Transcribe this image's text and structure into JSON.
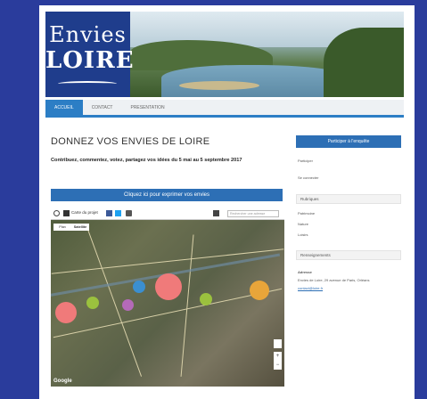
{
  "logo": {
    "line1": "Envies",
    "line2": "LOIRE"
  },
  "nav": {
    "items": [
      "ACCUEIL",
      "CONTACT",
      "PRESENTATION"
    ]
  },
  "main": {
    "title": "DONNEZ VOS ENVIES DE LOIRE",
    "intro": "Contribuez, commentez, votez, partagez vos idées du 5 mai au 5 septembre 2017",
    "cta": "Cliquez ici pour exprimer vos envies"
  },
  "map": {
    "toolbar_label": "Carte du projet",
    "search_placeholder": "Rechercher une adresse",
    "type_plan": "Plan",
    "type_satellite": "Satellite",
    "zoom_in": "+",
    "zoom_out": "−",
    "attribution": "Google",
    "markers": [
      {
        "color": "#f07a7a",
        "label": "marker-1"
      },
      {
        "color": "#9bc13e",
        "label": "marker-2"
      },
      {
        "color": "#b46ab8",
        "label": "marker-3"
      },
      {
        "color": "#3b8fd0",
        "label": "marker-4"
      },
      {
        "color": "#f07a7a",
        "label": "marker-5"
      },
      {
        "color": "#9bc13e",
        "label": "marker-6"
      },
      {
        "color": "#e8a53a",
        "label": "marker-7"
      }
    ]
  },
  "sidebar": {
    "button": "Participer à l'enquête",
    "link1": "Participer",
    "link2": "Se connecter",
    "box1_title": "Rubriques",
    "list": [
      "Patrimoine",
      "Nature",
      "Loisirs"
    ],
    "box2_title": "Renseignements",
    "contact_name": "Adresse",
    "contact_addr": "Envies de Loire, 29 avenue de Paris, Orléans",
    "contact_link": "contact@loire.fr"
  }
}
